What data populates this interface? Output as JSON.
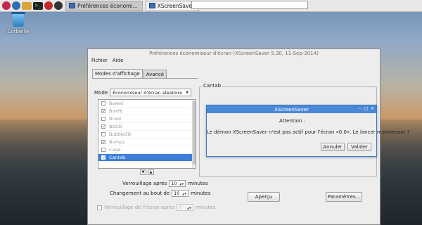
{
  "taskbar": {
    "tasks": [
      {
        "label": "Préférences économi..."
      },
      {
        "label": "XScreenSaver"
      }
    ]
  },
  "desktop": {
    "trash_label": "Corbeille"
  },
  "window": {
    "title": "Préférences économiseur d'écran  (XScreenSaver 5.30, 11-Sep-2014)",
    "menu": [
      "Fichier",
      "Aide"
    ],
    "tabs": [
      "Modes d'affichage",
      "Avancé"
    ],
    "mode_label": "Mode",
    "mode_value": "Économiseur d'écran aléatoire",
    "list_items": [
      {
        "label": "Boxed",
        "checked": false
      },
      {
        "label": "BoxFit",
        "checked": true
      },
      {
        "label": "Braid",
        "checked": false
      },
      {
        "label": "BSOD",
        "checked": true
      },
      {
        "label": "Bubble3D",
        "checked": false
      },
      {
        "label": "Bumps",
        "checked": true
      },
      {
        "label": "Cage",
        "checked": false
      },
      {
        "label": "Cantab",
        "checked": true,
        "selected": true
      }
    ],
    "lock_after_label": "Verrouillage après",
    "lock_after_value": "10",
    "change_after_label": "Changement au bout de",
    "change_after_value": "10",
    "minutes_label": "minutes",
    "lock_screen_label": "Verrouillage de l'écran après",
    "lock_screen_value": "0",
    "preview_group_title": "Cantab",
    "preview_button": "Aperçu",
    "settings_button": "Paramètres..."
  },
  "dialog": {
    "title": "XScreenSaver",
    "heading": "Attention :",
    "message": "Le démon XScreenSaver n'est pas actif pour l'écran «0.0». Le lancer maintenant ?",
    "cancel_button": "Annuler",
    "ok_button": "Valider"
  },
  "colors": {
    "selection": "#3d7fd6",
    "dialog_titlebar": "#4a88d8"
  }
}
